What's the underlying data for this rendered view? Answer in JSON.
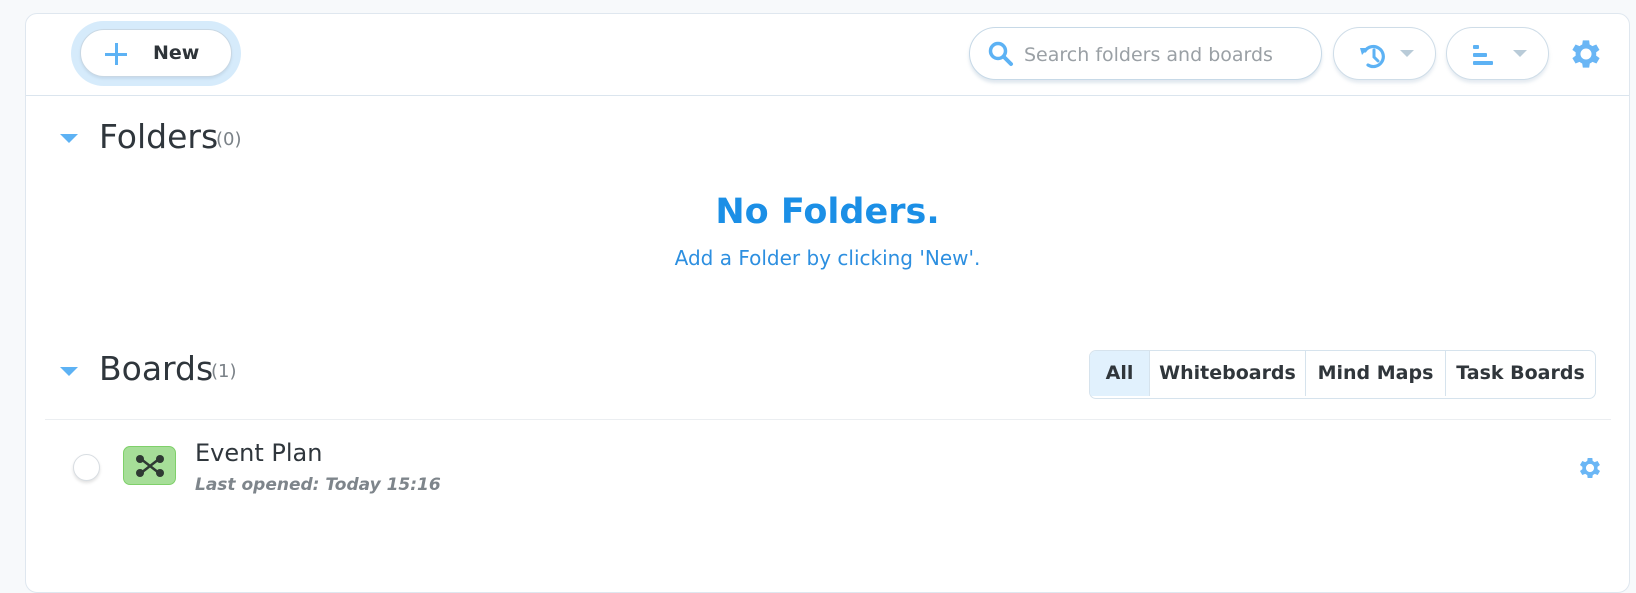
{
  "header": {
    "new_label": "New",
    "search_placeholder": "Search folders and boards",
    "history_icon": "history-icon",
    "sort_icon": "sort-icon",
    "settings_icon": "gear-icon"
  },
  "folders": {
    "title": "Folders",
    "count": "(0)",
    "empty_title": "No Folders.",
    "empty_subtitle": "Add a Folder by clicking 'New'."
  },
  "boards": {
    "title": "Boards",
    "count": "(1)",
    "filters": [
      {
        "label": "All",
        "active": true
      },
      {
        "label": "Whiteboards",
        "active": false
      },
      {
        "label": "Mind Maps",
        "active": false
      },
      {
        "label": "Task Boards",
        "active": false
      }
    ],
    "items": [
      {
        "name": "Event Plan",
        "meta": "Last opened: Today 15:16",
        "icon": "mind-map-icon",
        "icon_color": "#a6de98"
      }
    ]
  },
  "colors": {
    "accent": "#5db2f4",
    "empty_text": "#1b8fe6",
    "active_tab_bg": "#e1f1fd"
  }
}
